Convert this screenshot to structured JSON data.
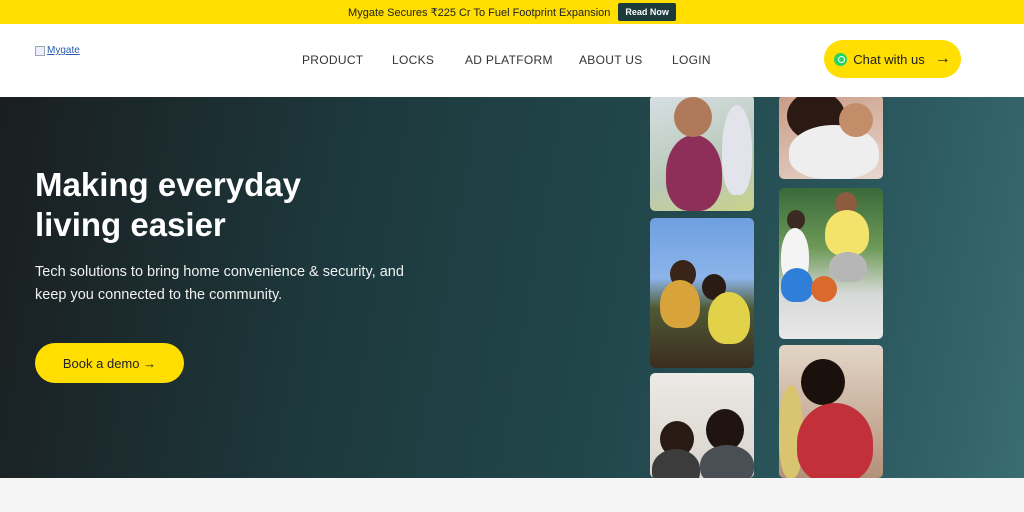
{
  "announcement": {
    "text": "Mygate Secures ₹225 Cr To Fuel Footprint Expansion",
    "cta": "Read Now"
  },
  "header": {
    "logo_alt": "Mygate",
    "nav": [
      "PRODUCT",
      "LOCKS",
      "AD PLATFORM",
      "ABOUT US",
      "LOGIN"
    ],
    "chat_label": "Chat with us",
    "chat_icon": "whatsapp-icon"
  },
  "hero": {
    "headline": "Making everyday living easier",
    "subtext": "Tech solutions to bring home convenience & security, and keep you connected to the community.",
    "cta": "Book a demo →"
  },
  "colors": {
    "accent_yellow": "#ffde00",
    "dark_teal": "#1b3b3d",
    "hero_gradient_start": "#1a1e20",
    "hero_gradient_end": "#3a6c73"
  }
}
